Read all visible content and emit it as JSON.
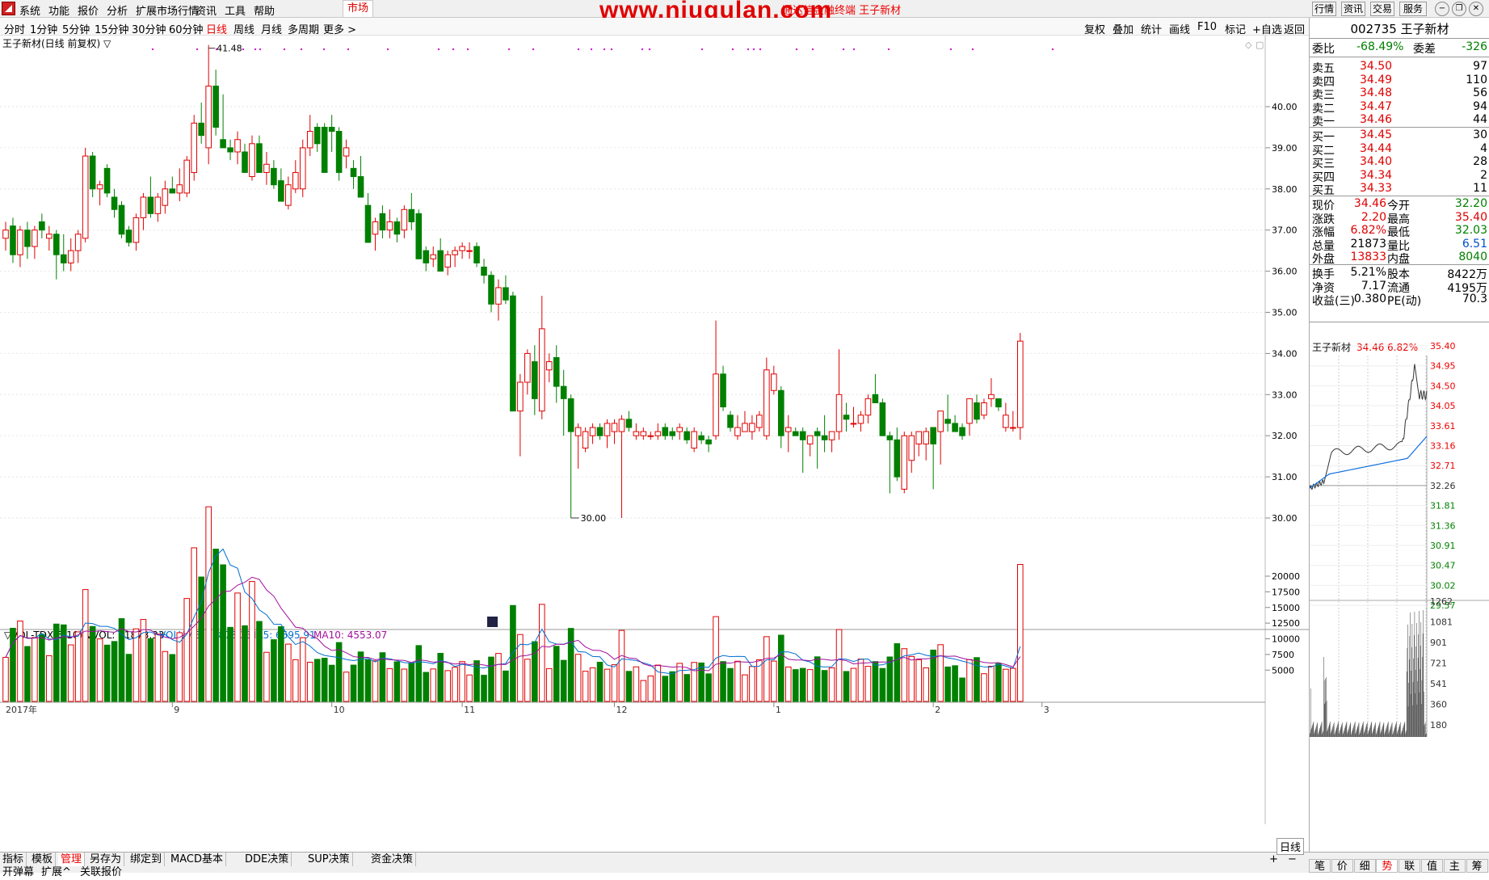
{
  "menu": {
    "items": [
      "系统",
      "功能",
      "报价",
      "分析",
      "扩展市场行情",
      "资讯",
      "工具",
      "帮助"
    ],
    "market": "市场",
    "watermark": "www.niugulan.com",
    "subtitle": "通达信金融终端 王子新材",
    "top_buttons": [
      "行情",
      "资讯",
      "交易",
      "服务"
    ]
  },
  "periods": [
    "分时",
    "1分钟",
    "5分钟",
    "15分钟",
    "30分钟",
    "60分钟",
    "日线",
    "周线",
    "月线",
    "多周期",
    "更多 >"
  ],
  "active_period": "日线",
  "right_tools": [
    "复权",
    "叠加",
    "统计",
    "画线",
    "F10",
    "标记",
    "+自选",
    "返回"
  ],
  "chart_title": "王子新材(日线 前复权) ▽",
  "vol_title": {
    "name": "▽VOL-TDX(5,10) VVOL: 21873.33",
    "volume": "VOLUME: 21873.33",
    "ma5": "MA5: 6595.91",
    "ma10": "MA10: 4553.07"
  },
  "date_labels": [
    "2017年",
    "9",
    "10",
    "11",
    "12",
    "1",
    "2",
    "3"
  ],
  "price_ticks": [
    "40.00",
    "39.00",
    "38.00",
    "37.00",
    "36.00",
    "35.00",
    "34.00",
    "33.00",
    "32.00",
    "31.00",
    "30.00"
  ],
  "vol_ticks": [
    "20000",
    "17500",
    "15000",
    "12500",
    "10000",
    "7500",
    "5000"
  ],
  "max_label": "41.48",
  "min_label": "30.00",
  "colors": {
    "up": "#e00000",
    "down": "#008000",
    "ma5": "#0070d0",
    "ma10": "#a0109a"
  },
  "chart_data": {
    "type": "candlestick",
    "ohlc": [
      [
        36.8,
        37.2,
        36.5,
        37.0
      ],
      [
        37.1,
        37.3,
        36.2,
        36.4
      ],
      [
        36.4,
        37.1,
        36.1,
        37.0
      ],
      [
        37.0,
        37.2,
        36.3,
        36.6
      ],
      [
        36.6,
        37.1,
        36.3,
        37.0
      ],
      [
        37.2,
        37.4,
        36.8,
        37.0
      ],
      [
        36.8,
        37.1,
        36.5,
        36.9
      ],
      [
        36.9,
        37.0,
        35.8,
        36.4
      ],
      [
        36.4,
        36.9,
        36.0,
        36.2
      ],
      [
        36.2,
        36.8,
        36.0,
        36.5
      ],
      [
        36.5,
        37.0,
        36.2,
        36.9
      ],
      [
        36.8,
        39.0,
        36.7,
        38.8
      ],
      [
        38.8,
        38.9,
        37.8,
        38.0
      ],
      [
        38.0,
        38.2,
        37.6,
        38.1
      ],
      [
        38.5,
        38.6,
        37.8,
        37.9
      ],
      [
        37.8,
        38.0,
        37.3,
        37.5
      ],
      [
        37.6,
        37.7,
        36.8,
        36.9
      ],
      [
        37.0,
        37.1,
        36.6,
        36.7
      ],
      [
        36.7,
        37.4,
        36.5,
        37.3
      ],
      [
        37.3,
        37.9,
        37.0,
        37.8
      ],
      [
        37.8,
        38.3,
        37.3,
        37.4
      ],
      [
        37.4,
        37.9,
        37.2,
        37.8
      ],
      [
        37.6,
        38.2,
        37.4,
        38.0
      ],
      [
        38.0,
        38.3,
        37.9,
        37.9
      ],
      [
        37.9,
        38.5,
        37.7,
        38.1
      ],
      [
        37.9,
        38.8,
        37.8,
        38.7
      ],
      [
        38.4,
        39.8,
        38.2,
        39.6
      ],
      [
        39.6,
        40.1,
        39.1,
        39.3
      ],
      [
        39.0,
        41.5,
        38.6,
        40.5
      ],
      [
        40.5,
        40.9,
        39.3,
        39.5
      ],
      [
        39.2,
        40.3,
        39.0,
        39.0
      ],
      [
        39.0,
        39.2,
        38.7,
        38.9
      ],
      [
        38.9,
        39.4,
        38.6,
        39.2
      ],
      [
        38.9,
        39.1,
        38.5,
        38.4
      ],
      [
        38.3,
        39.3,
        38.2,
        39.1
      ],
      [
        39.1,
        39.3,
        38.4,
        38.4
      ],
      [
        38.4,
        38.9,
        38.1,
        38.6
      ],
      [
        38.5,
        38.7,
        38.0,
        38.1
      ],
      [
        38.2,
        38.5,
        37.8,
        37.7
      ],
      [
        37.6,
        38.3,
        37.5,
        38.1
      ],
      [
        38.0,
        38.7,
        37.9,
        38.4
      ],
      [
        38.0,
        39.2,
        37.8,
        39.0
      ],
      [
        39.0,
        39.8,
        38.8,
        39.4
      ],
      [
        39.5,
        39.6,
        38.9,
        39.1
      ],
      [
        39.5,
        39.6,
        38.5,
        38.4
      ],
      [
        39.5,
        39.8,
        38.9,
        39.4
      ],
      [
        39.4,
        39.5,
        38.2,
        38.4
      ],
      [
        38.8,
        39.2,
        38.5,
        39.0
      ],
      [
        38.5,
        38.7,
        38.0,
        38.3
      ],
      [
        38.3,
        38.8,
        37.9,
        37.8
      ],
      [
        37.6,
        37.9,
        37.0,
        36.7
      ],
      [
        36.9,
        37.3,
        36.5,
        37.2
      ],
      [
        37.4,
        37.6,
        36.8,
        37.0
      ],
      [
        37.0,
        37.5,
        36.8,
        37.2
      ],
      [
        37.2,
        37.3,
        36.7,
        36.9
      ],
      [
        37.0,
        37.6,
        36.8,
        37.5
      ],
      [
        37.5,
        37.9,
        37.0,
        37.2
      ],
      [
        37.4,
        37.5,
        36.5,
        36.3
      ],
      [
        36.5,
        36.6,
        36.0,
        36.2
      ],
      [
        36.3,
        36.6,
        36.1,
        36.4
      ],
      [
        36.5,
        36.8,
        36.0,
        36.0
      ],
      [
        36.1,
        36.5,
        35.9,
        36.4
      ],
      [
        36.4,
        36.6,
        36.1,
        36.5
      ],
      [
        36.5,
        36.7,
        36.3,
        36.6
      ],
      [
        36.5,
        36.7,
        36.3,
        36.5
      ],
      [
        36.6,
        36.7,
        36.1,
        36.2
      ],
      [
        36.1,
        36.3,
        35.7,
        35.9
      ],
      [
        35.9,
        36.0,
        35.0,
        35.2
      ],
      [
        35.2,
        35.8,
        34.8,
        35.6
      ],
      [
        35.6,
        35.9,
        35.2,
        35.3
      ],
      [
        35.4,
        35.5,
        32.6,
        32.6
      ],
      [
        32.6,
        33.5,
        31.5,
        33.3
      ],
      [
        33.3,
        34.1,
        33.0,
        34.0
      ],
      [
        33.8,
        34.2,
        32.5,
        32.9
      ],
      [
        32.6,
        35.4,
        32.4,
        34.6
      ],
      [
        33.6,
        34.0,
        33.3,
        33.8
      ],
      [
        33.9,
        34.2,
        32.8,
        33.2
      ],
      [
        33.2,
        33.6,
        32.0,
        32.9
      ],
      [
        32.9,
        33.0,
        30.0,
        32.1
      ],
      [
        32.0,
        32.3,
        31.2,
        32.2
      ],
      [
        31.7,
        32.2,
        31.6,
        32.1
      ],
      [
        32.0,
        32.3,
        31.8,
        32.2
      ],
      [
        32.2,
        32.3,
        31.9,
        32.0
      ],
      [
        32.0,
        32.4,
        31.7,
        32.3
      ],
      [
        32.1,
        32.4,
        31.8,
        32.3
      ],
      [
        32.1,
        32.5,
        30.0,
        32.4
      ],
      [
        32.4,
        32.6,
        32.1,
        32.2
      ],
      [
        32.0,
        32.3,
        31.9,
        32.1
      ],
      [
        32.0,
        32.2,
        31.9,
        32.1
      ],
      [
        32.0,
        32.1,
        31.9,
        32.0
      ],
      [
        32.0,
        32.3,
        31.9,
        32.1
      ],
      [
        32.2,
        32.3,
        31.9,
        32.0
      ],
      [
        32.1,
        32.2,
        31.9,
        32.0
      ],
      [
        32.1,
        32.3,
        31.9,
        32.2
      ],
      [
        32.1,
        32.2,
        31.8,
        31.9
      ],
      [
        31.7,
        32.2,
        31.6,
        32.1
      ],
      [
        32.0,
        32.1,
        31.8,
        31.9
      ],
      [
        31.9,
        32.0,
        31.6,
        31.8
      ],
      [
        32.0,
        34.8,
        31.9,
        33.5
      ],
      [
        33.5,
        33.7,
        32.6,
        32.7
      ],
      [
        32.5,
        32.6,
        32.1,
        32.2
      ],
      [
        32.0,
        32.5,
        31.9,
        32.2
      ],
      [
        32.1,
        32.6,
        32.1,
        32.3
      ],
      [
        32.1,
        32.5,
        31.9,
        32.3
      ],
      [
        32.2,
        32.6,
        32.1,
        32.5
      ],
      [
        32.0,
        33.9,
        31.9,
        33.6
      ],
      [
        33.1,
        33.7,
        33.0,
        33.5
      ],
      [
        33.1,
        33.2,
        31.7,
        32.0
      ],
      [
        32.1,
        32.5,
        31.6,
        32.2
      ],
      [
        32.1,
        32.2,
        32.0,
        32.0
      ],
      [
        32.1,
        32.2,
        31.1,
        31.9
      ],
      [
        31.8,
        32.0,
        31.5,
        32.0
      ],
      [
        32.1,
        32.2,
        31.2,
        32.0
      ],
      [
        32.0,
        32.5,
        31.6,
        31.9
      ],
      [
        31.9,
        32.1,
        31.6,
        32.1
      ],
      [
        32.1,
        34.1,
        31.9,
        33.0
      ],
      [
        32.5,
        32.8,
        32.1,
        32.4
      ],
      [
        32.3,
        32.7,
        32.2,
        32.3
      ],
      [
        32.3,
        32.6,
        32.1,
        32.5
      ],
      [
        32.5,
        33.0,
        32.3,
        32.9
      ],
      [
        33.0,
        33.5,
        32.8,
        32.8
      ],
      [
        32.8,
        32.9,
        32.3,
        32.0
      ],
      [
        32.0,
        32.1,
        30.6,
        31.9
      ],
      [
        31.9,
        32.2,
        30.9,
        31.0
      ],
      [
        30.7,
        32.1,
        30.6,
        32.0
      ],
      [
        31.4,
        32.1,
        31.1,
        32.0
      ],
      [
        31.8,
        32.0,
        31.5,
        32.1
      ],
      [
        31.8,
        32.2,
        31.4,
        32.1
      ],
      [
        32.2,
        32.2,
        30.7,
        31.8
      ],
      [
        32.1,
        32.6,
        31.3,
        32.6
      ],
      [
        32.4,
        33.0,
        32.1,
        32.3
      ],
      [
        32.3,
        32.5,
        32.1,
        32.1
      ],
      [
        32.2,
        32.3,
        31.9,
        32.0
      ],
      [
        32.3,
        32.9,
        32.0,
        32.9
      ],
      [
        32.8,
        33.0,
        32.3,
        32.4
      ],
      [
        32.5,
        32.9,
        32.4,
        32.8
      ],
      [
        32.9,
        33.4,
        32.7,
        33.0
      ],
      [
        32.9,
        32.9,
        32.6,
        32.7
      ],
      [
        32.2,
        32.8,
        32.1,
        32.5
      ],
      [
        32.2,
        32.6,
        32.1,
        32.2
      ],
      [
        32.2,
        34.5,
        31.9,
        34.3
      ]
    ],
    "volume_ylim": [
      0,
      21873
    ],
    "price_ylim": [
      30,
      41.5
    ]
  },
  "quote": {
    "code_name": "002735 王子新材",
    "weibi_label": "委比",
    "weibi": "-68.49%",
    "weicha_label": "委差",
    "weicha": "-326",
    "sells": [
      {
        "label": "卖五",
        "price": "34.50",
        "vol": "97"
      },
      {
        "label": "卖四",
        "price": "34.49",
        "vol": "110"
      },
      {
        "label": "卖三",
        "price": "34.48",
        "vol": "56"
      },
      {
        "label": "卖二",
        "price": "34.47",
        "vol": "94"
      },
      {
        "label": "卖一",
        "price": "34.46",
        "vol": "44"
      }
    ],
    "buys": [
      {
        "label": "买一",
        "price": "34.45",
        "vol": "30"
      },
      {
        "label": "买二",
        "price": "34.44",
        "vol": "4"
      },
      {
        "label": "买三",
        "price": "34.40",
        "vol": "28"
      },
      {
        "label": "买四",
        "price": "34.34",
        "vol": "2"
      },
      {
        "label": "买五",
        "price": "34.33",
        "vol": "11"
      }
    ],
    "stats": [
      {
        "l1": "现价",
        "v1": "34.46",
        "l2": "今开",
        "v2": "32.20",
        "c1": "red",
        "c2": "green"
      },
      {
        "l1": "涨跌",
        "v1": "2.20",
        "l2": "最高",
        "v2": "35.40",
        "c1": "red",
        "c2": "red"
      },
      {
        "l1": "涨幅",
        "v1": "6.82%",
        "l2": "最低",
        "v2": "32.03",
        "c1": "red",
        "c2": "green"
      },
      {
        "l1": "总量",
        "v1": "21873",
        "l2": "量比",
        "v2": "6.51",
        "c1": "",
        "c2": "blue"
      },
      {
        "l1": "外盘",
        "v1": "13833",
        "l2": "内盘",
        "v2": "8040",
        "c1": "red",
        "c2": "green"
      }
    ],
    "stats2": [
      {
        "l1": "换手",
        "v1": "5.21%",
        "l2": "股本",
        "v2": "8422万"
      },
      {
        "l1": "净资",
        "v1": "7.17",
        "l2": "流通",
        "v2": "4195万"
      },
      {
        "l1": "收益(三)",
        "v1": "0.380",
        "l2": "PE(动)",
        "v2": "70.3"
      }
    ],
    "mini_title": "王子新材",
    "mini_price": "34.46",
    "mini_pct": "6.82%",
    "mini_price_ticks_red": [
      "35.40",
      "34.95",
      "34.50",
      "34.05",
      "33.61",
      "33.16",
      "32.71"
    ],
    "mini_price_base": "32.26",
    "mini_price_ticks_green": [
      "31.81",
      "31.36",
      "30.91",
      "30.47",
      "30.02",
      "29.57"
    ],
    "mini_vol_ticks": [
      "1262",
      "1081",
      "901",
      "721",
      "541",
      "360",
      "180"
    ]
  },
  "bottom": {
    "tabs1": [
      "指标",
      "模板",
      "管理",
      "另存为",
      "绑定到",
      "MACD基本",
      "DDE决策",
      "SUP决策",
      "资金决策"
    ],
    "active": "管理",
    "tabs2": [
      "开弹幕",
      "扩展^",
      "关联报价"
    ],
    "right_label": "日线",
    "right_tabs": [
      "笔",
      "价",
      "细",
      "势",
      "联",
      "值",
      "主",
      "筹"
    ],
    "right_active": "势",
    "zoom": [
      "+",
      "−"
    ]
  }
}
